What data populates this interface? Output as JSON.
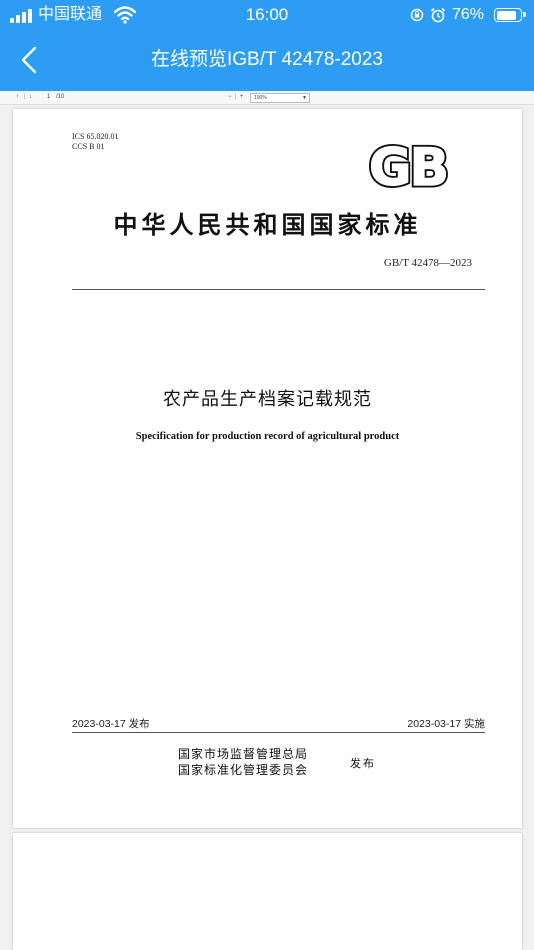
{
  "status_bar": {
    "carrier": "中国联通",
    "time": "16:00",
    "battery_percent": "76%",
    "battery_level": 0.76,
    "icons": [
      "signal-icon",
      "wifi-icon",
      "rotation-lock-icon",
      "alarm-icon",
      "battery-icon"
    ]
  },
  "nav": {
    "title": "在线预览IGB/T 42478-2023",
    "back_icon": "chevron-left-icon"
  },
  "pdf_toolbar": {
    "page_current": "1",
    "page_total": "/10",
    "zoom": "100%"
  },
  "document": {
    "ics": "ICS 65.020.01",
    "ccs": "CCS B 01",
    "logo_text": "GB",
    "standard_title": "中华人民共和国国家标准",
    "standard_code": "GB/T 42478—2023",
    "title_cn": "农产品生产档案记载规范",
    "title_en": "Specification for production record of agricultural product",
    "published": "2023-03-17 发布",
    "implemented": "2023-03-17 实施",
    "issuer_1": "国家市场监督管理总局",
    "issuer_2": "国家标准化管理委员会",
    "issue_verb": "发布"
  },
  "colors": {
    "header_blue": "#2d9cf3"
  }
}
